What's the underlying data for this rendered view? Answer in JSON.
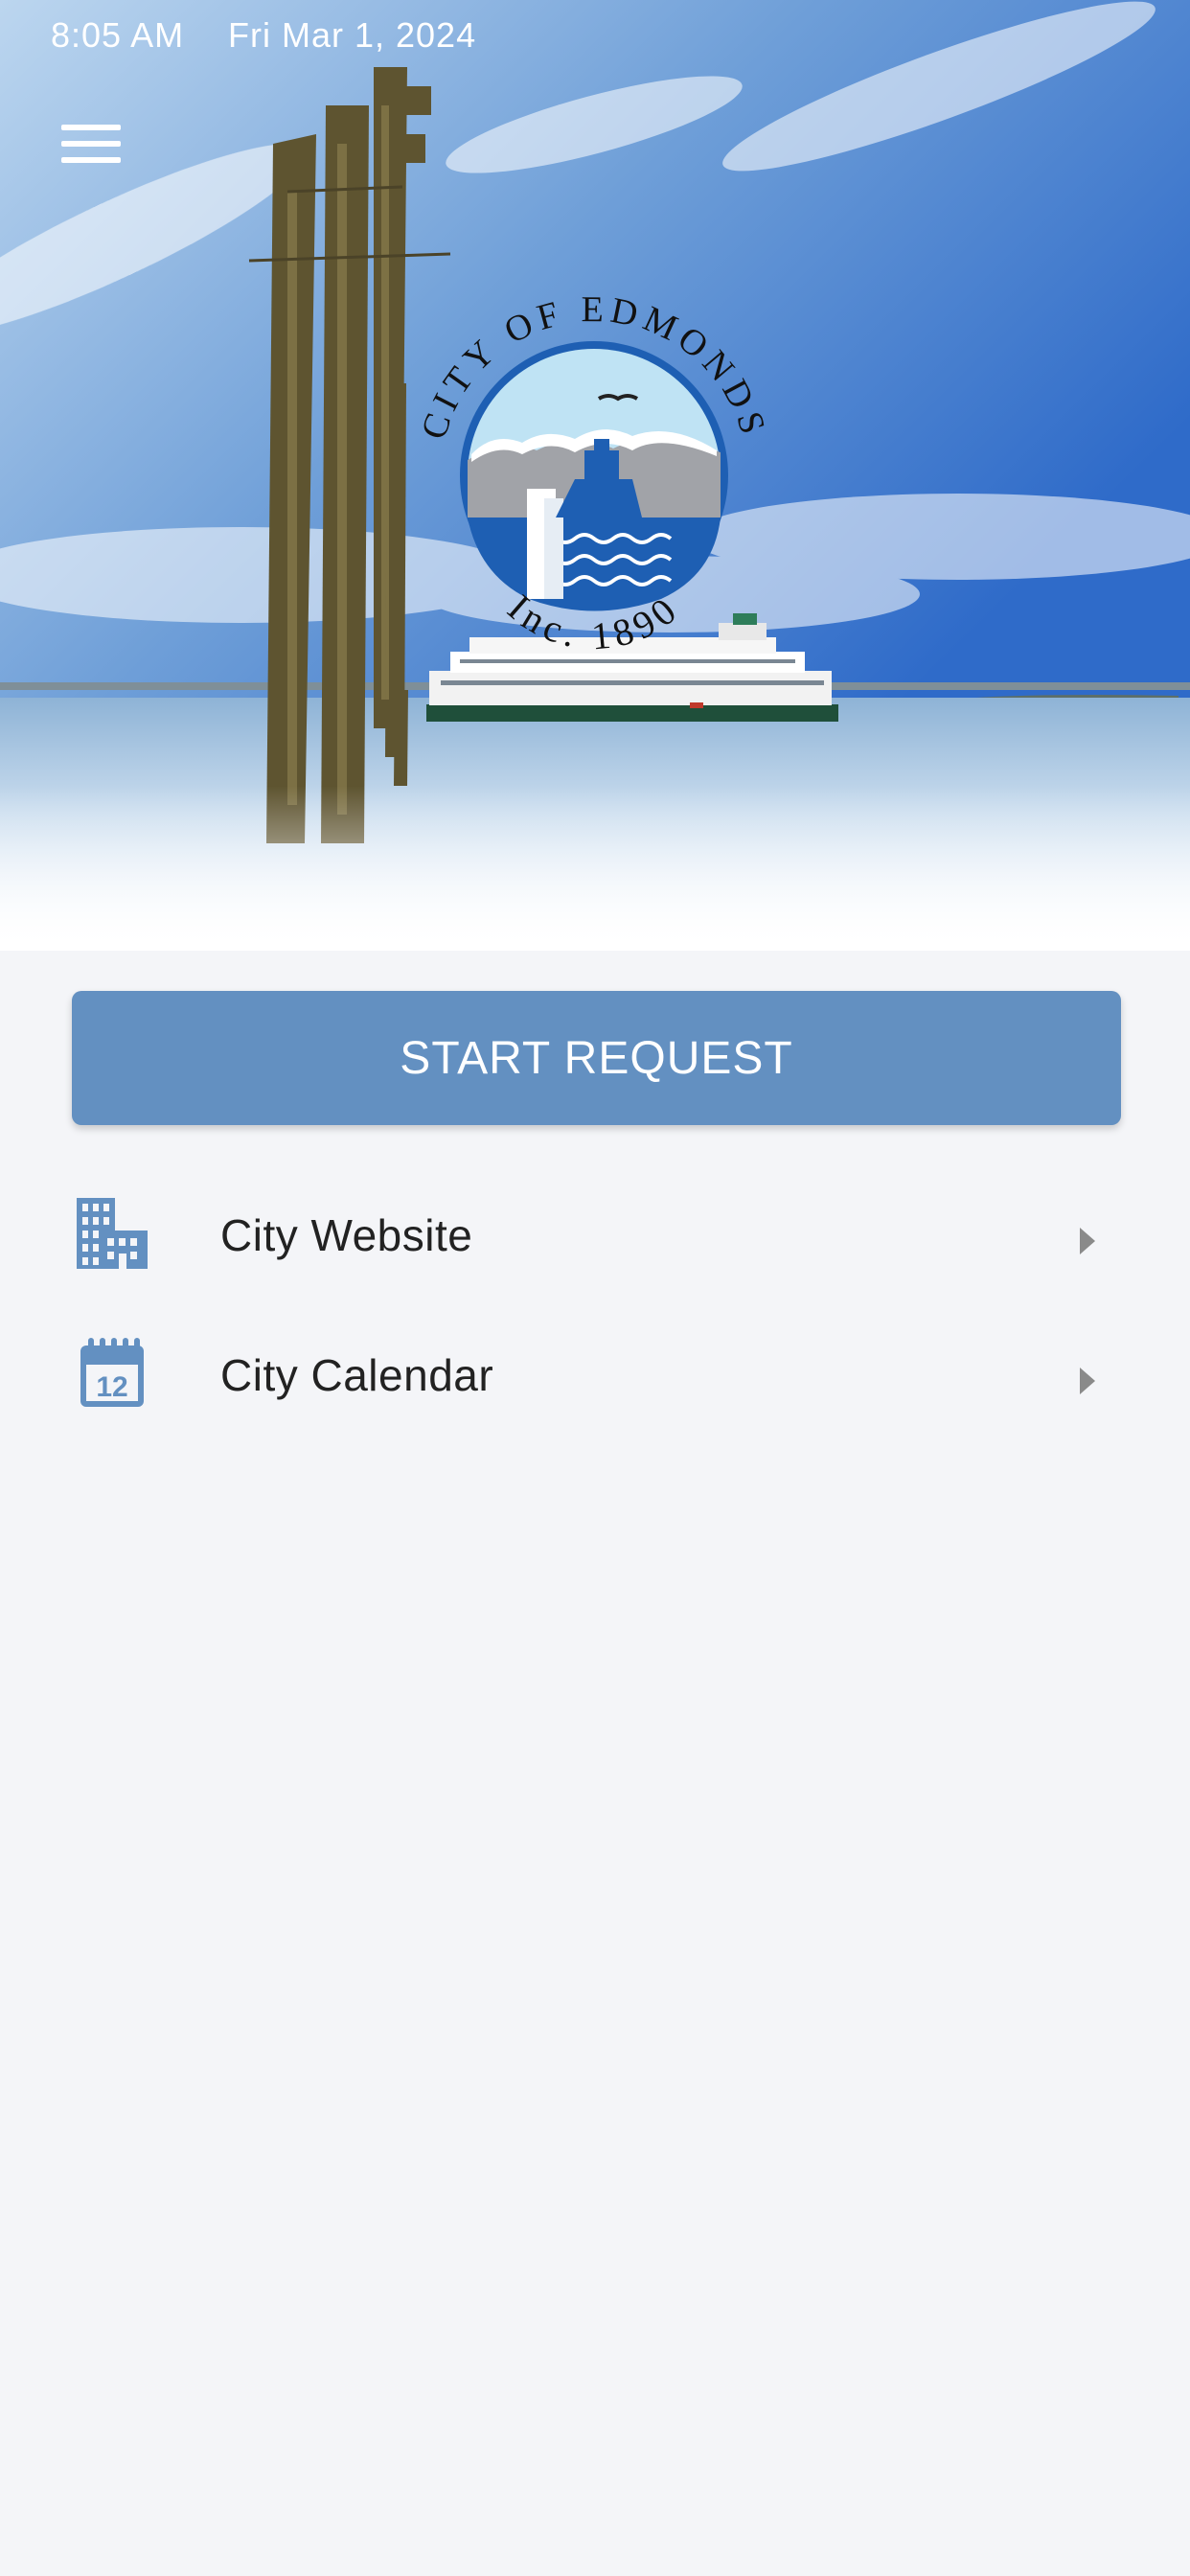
{
  "status_bar": {
    "time": "8:05 AM",
    "date": "Fri Mar 1, 2024"
  },
  "logo": {
    "top_text": "CITY OF EDMONDS",
    "bottom_text": "Inc. 1890"
  },
  "actions": {
    "start_request": "START REQUEST"
  },
  "menu_items": [
    {
      "label": "City Website",
      "icon": "building-icon"
    },
    {
      "label": "City Calendar",
      "icon": "calendar-icon"
    }
  ],
  "colors": {
    "accent": "#6390c1",
    "icon": "#6390c1",
    "background": "#f4f5f8"
  }
}
